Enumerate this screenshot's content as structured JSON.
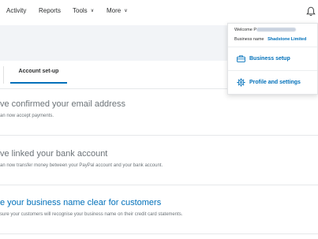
{
  "nav": {
    "activity": "Activity",
    "reports": "Reports",
    "tools": "Tools",
    "more": "More"
  },
  "tabs": {
    "account_setup": "Account set-up"
  },
  "checklist": [
    {
      "title": "ve confirmed your email address",
      "desc": "an now accept payments."
    },
    {
      "title": "ve linked your bank account",
      "desc": "an now transfer money between your PayPal account and your bank account."
    },
    {
      "title": "e your business name clear for customers",
      "desc": "sure your customers will recognise your business name on their credit card statements."
    }
  ],
  "dropdown": {
    "welcome_label": "Welcome",
    "welcome_initial": "P",
    "business_label": "Business name",
    "business_name": "Shadstone Limited",
    "business_setup": "Business setup",
    "profile_settings": "Profile and settings"
  },
  "colors": {
    "accent": "#0070ba",
    "muted_text": "#6c7378",
    "band": "#f2f4f7"
  },
  "icons": {
    "notifications": "bell-icon",
    "business_setup": "briefcase-icon",
    "profile_settings": "gear-icon"
  }
}
